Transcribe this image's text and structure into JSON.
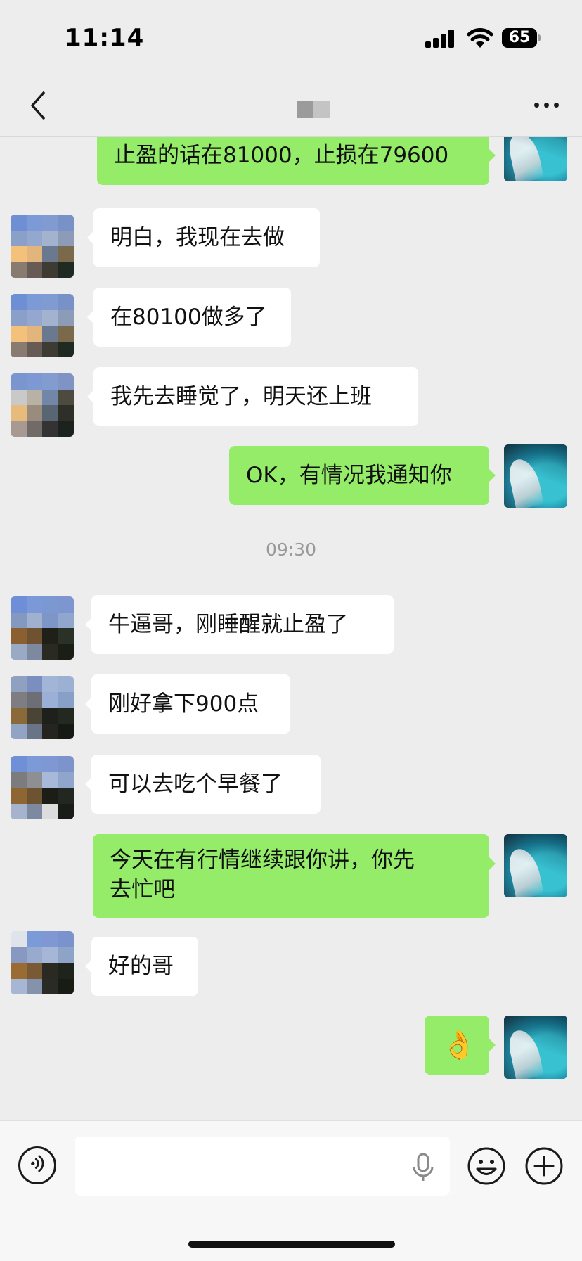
{
  "status_bar": {
    "time": "11:14",
    "battery": "65"
  },
  "nav": {
    "title": ""
  },
  "messages": [
    {
      "side": "self",
      "text": "止盈的话在81000，止损在79600"
    },
    {
      "side": "other",
      "text": "明白，我现在去做"
    },
    {
      "side": "other",
      "text": "在80100做多了"
    },
    {
      "side": "other",
      "text": "我先去睡觉了，明天还上班"
    },
    {
      "side": "self",
      "text": "OK，有情况我通知你"
    },
    {
      "side": "other",
      "text": "牛逼哥，刚睡醒就止盈了"
    },
    {
      "side": "other",
      "text": "刚好拿下900点"
    },
    {
      "side": "other",
      "text": "可以去吃个早餐了"
    },
    {
      "side": "self",
      "text": "今天在有行情继续跟你讲，你先\n去忙吧"
    },
    {
      "side": "other",
      "text": "好的哥"
    },
    {
      "side": "self",
      "text": "👌"
    }
  ],
  "time_divider": "09:30",
  "input": {
    "value": "",
    "placeholder": ""
  },
  "icons": {
    "back": "chevron-left-icon",
    "more": "more-icon",
    "voice": "voice-icon",
    "mic": "mic-icon",
    "emoji": "emoji-icon",
    "plus": "plus-icon"
  },
  "colors": {
    "self_bubble": "#95ec69",
    "other_bubble": "#ffffff",
    "background": "#ededed"
  }
}
